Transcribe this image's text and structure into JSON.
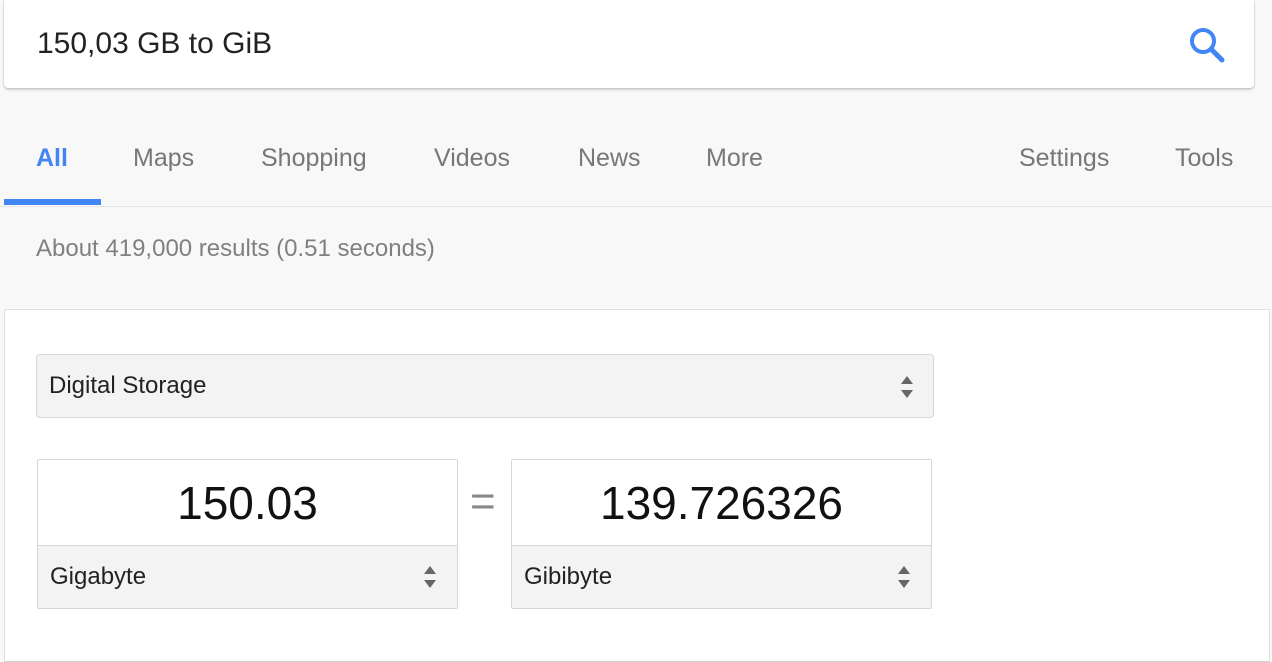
{
  "search": {
    "query": "150,03 GB to GiB"
  },
  "tabs": [
    {
      "label": "All",
      "active": true
    },
    {
      "label": "Maps"
    },
    {
      "label": "Shopping"
    },
    {
      "label": "Videos"
    },
    {
      "label": "News"
    },
    {
      "label": "More"
    },
    {
      "label": "Settings"
    },
    {
      "label": "Tools"
    }
  ],
  "results": {
    "stats": "About 419,000 results (0.51 seconds)"
  },
  "converter": {
    "category": "Digital Storage",
    "from_value": "150.03",
    "from_unit": "Gigabyte",
    "equals": "=",
    "to_value": "139.726326",
    "to_unit": "Gibibyte"
  },
  "colors": {
    "accent": "#4285f4",
    "tab_text": "#777777",
    "background": "#f8f8f8"
  },
  "icons": {
    "search": "search-icon",
    "select_arrows": "updown-arrows-icon"
  }
}
